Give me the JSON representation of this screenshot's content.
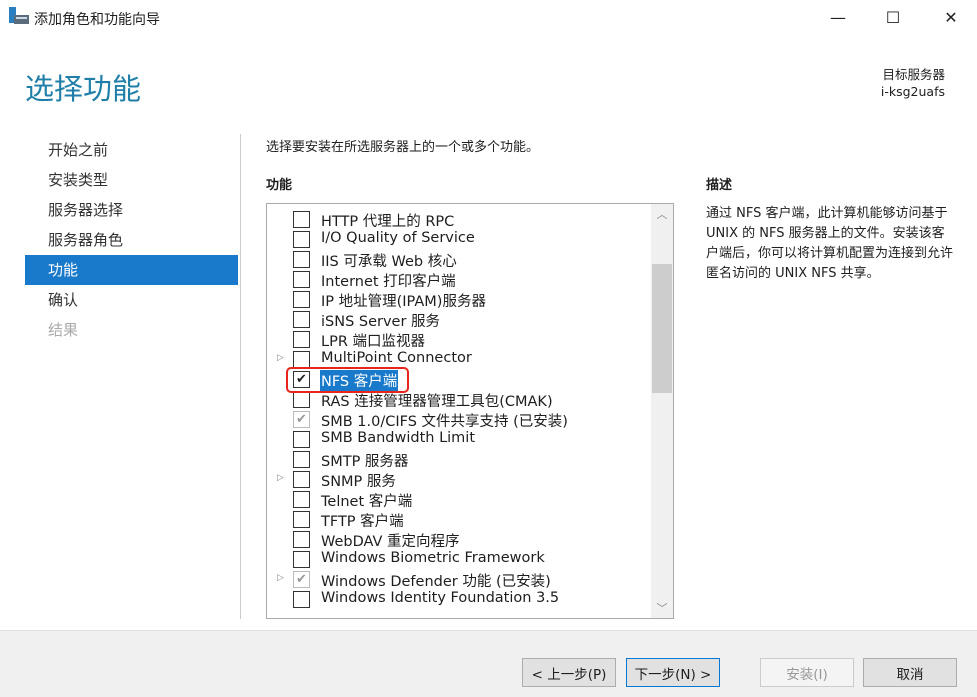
{
  "window": {
    "title": "添加角色和功能向导",
    "minimize": "—",
    "maximize": "☐",
    "close": "✕"
  },
  "header": {
    "title": "选择功能",
    "server_label": "目标服务器",
    "server_name": "i-ksg2uafs"
  },
  "nav": [
    {
      "label": "开始之前",
      "state": "normal"
    },
    {
      "label": "安装类型",
      "state": "normal"
    },
    {
      "label": "服务器选择",
      "state": "normal"
    },
    {
      "label": "服务器角色",
      "state": "normal"
    },
    {
      "label": "功能",
      "state": "selected"
    },
    {
      "label": "确认",
      "state": "normal"
    },
    {
      "label": "结果",
      "state": "disabled"
    }
  ],
  "main": {
    "intro": "选择要安装在所选服务器上的一个或多个功能。",
    "features_heading": "功能",
    "description_heading": "描述",
    "description": "通过 NFS 客户端，此计算机能够访问基于 UNIX 的 NFS 服务器上的文件。安装该客户端后，你可以将计算机配置为连接到允许匿名访问的 UNIX NFS 共享。",
    "features": [
      {
        "label": "HTTP 代理上的 RPC",
        "checked": false
      },
      {
        "label": "I/O Quality of Service",
        "checked": false
      },
      {
        "label": "IIS 可承载 Web 核心",
        "checked": false
      },
      {
        "label": "Internet 打印客户端",
        "checked": false
      },
      {
        "label": "IP 地址管理(IPAM)服务器",
        "checked": false
      },
      {
        "label": "iSNS Server 服务",
        "checked": false
      },
      {
        "label": "LPR 端口监视器",
        "checked": false
      },
      {
        "label": "MultiPoint Connector",
        "checked": false,
        "expandable": true
      },
      {
        "label": "NFS 客户端",
        "checked": true,
        "selected": true,
        "highlighted": true
      },
      {
        "label": "RAS 连接管理器管理工具包(CMAK)",
        "checked": false
      },
      {
        "label": "SMB 1.0/CIFS 文件共享支持 (已安装)",
        "checked": true,
        "disabled": true
      },
      {
        "label": "SMB Bandwidth Limit",
        "checked": false
      },
      {
        "label": "SMTP 服务器",
        "checked": false
      },
      {
        "label": "SNMP 服务",
        "checked": false,
        "expandable": true
      },
      {
        "label": "Telnet 客户端",
        "checked": false
      },
      {
        "label": "TFTP 客户端",
        "checked": false
      },
      {
        "label": "WebDAV 重定向程序",
        "checked": false
      },
      {
        "label": "Windows Biometric Framework",
        "checked": false
      },
      {
        "label": "Windows Defender 功能 (已安装)",
        "checked": true,
        "disabled": true,
        "expandable": true
      },
      {
        "label": "Windows Identity Foundation 3.5",
        "checked": false
      }
    ]
  },
  "footer": {
    "prev": "< 上一步(P)",
    "next": "下一步(N) >",
    "install": "安装(I)",
    "cancel": "取消"
  },
  "colors": {
    "accent": "#1979ca",
    "title": "#1f7fa8",
    "highlight_ring": "#e8251b"
  }
}
